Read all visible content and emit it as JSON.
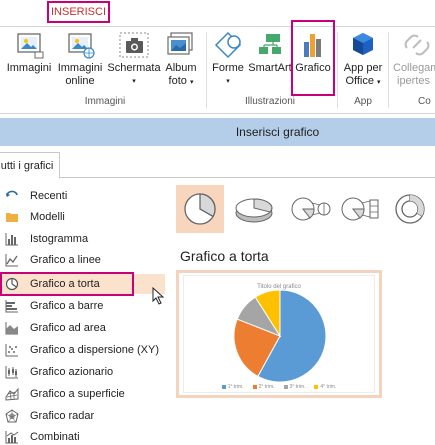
{
  "ribbon": {
    "active_tab": "INSERISCI",
    "buttons": {
      "immagini": "Immagini",
      "immagini_online_1": "Immagini",
      "immagini_online_2": "online",
      "schermata": "Schermata",
      "album_1": "Album",
      "album_2": "foto",
      "forme": "Forme",
      "smartart": "SmartArt",
      "grafico": "Grafico",
      "app_1": "App per",
      "app_2": "Office",
      "collegamento_1": "Collegam",
      "collegamento_2": "ipertes",
      "commenti": "Col"
    },
    "groups": {
      "immagini": "Immagini",
      "illustrazioni": "Illustrazioni",
      "app": "App",
      "commenti": "Co"
    }
  },
  "dialog": {
    "title": "Inserisci grafico",
    "tab_all": "utti i grafici",
    "chart_types": [
      {
        "label": "Recenti",
        "icon": "undo-arrow-icon"
      },
      {
        "label": "Modelli",
        "icon": "folder-icon"
      },
      {
        "label": "Istogramma",
        "icon": "column-chart-icon"
      },
      {
        "label": "Grafico a linee",
        "icon": "line-chart-icon"
      },
      {
        "label": "Grafico a torta",
        "icon": "pie-chart-icon"
      },
      {
        "label": "Grafico a barre",
        "icon": "bar-chart-icon"
      },
      {
        "label": "Grafico ad area",
        "icon": "area-chart-icon"
      },
      {
        "label": "Grafico a dispersione (XY)",
        "icon": "scatter-chart-icon"
      },
      {
        "label": "Grafico azionario",
        "icon": "stock-chart-icon"
      },
      {
        "label": "Grafico a superficie",
        "icon": "surface-chart-icon"
      },
      {
        "label": "Grafico radar",
        "icon": "radar-chart-icon"
      },
      {
        "label": "Combinati",
        "icon": "combo-chart-icon"
      }
    ],
    "selected_type": "Grafico a torta",
    "subtype_title": "Grafico a torta",
    "preview": {
      "title": "Titolo del grafico",
      "legend": [
        "1° trim.",
        "2° trim.",
        "3° trim.",
        "4° trim."
      ],
      "colors": [
        "#5b9bd5",
        "#ed7d31",
        "#a5a5a5",
        "#ffc000"
      ]
    }
  },
  "colors": {
    "accent_highlight": "#c8007a",
    "tab_text": "#c8302e",
    "dialog_title_bar": "#b4cde9",
    "selection": "#fbe2cd"
  },
  "chart_data": {
    "type": "pie",
    "categories": [
      "1° trim.",
      "2° trim.",
      "3° trim.",
      "4° trim."
    ],
    "values": [
      58,
      23,
      10,
      9
    ],
    "title": "Titolo del grafico"
  }
}
